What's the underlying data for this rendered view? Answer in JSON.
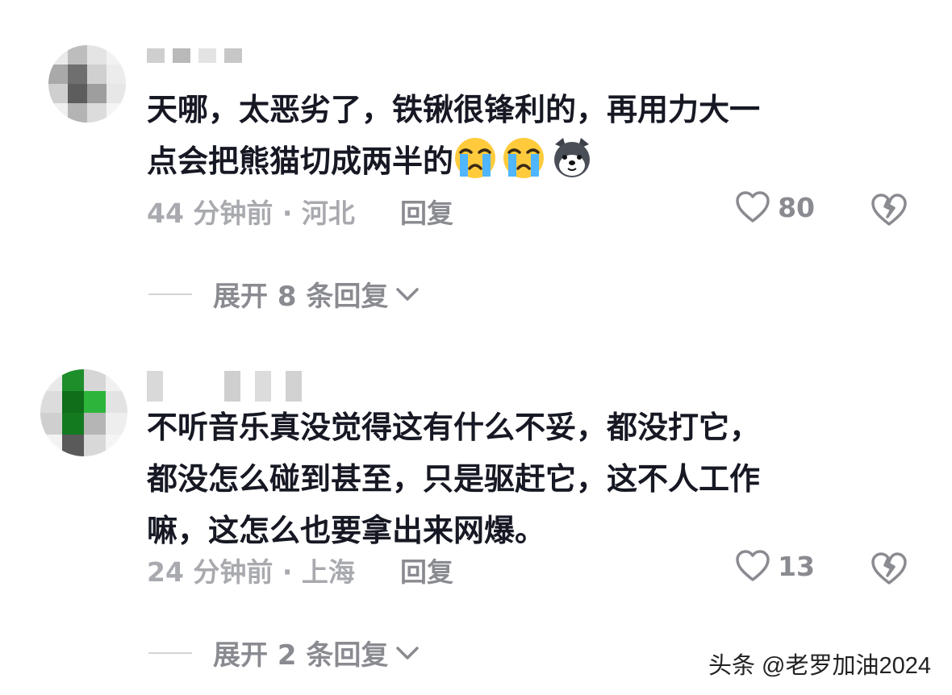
{
  "comments": [
    {
      "text_line1": "天哪，太恶劣了，铁锹很锋利的，再用力大一",
      "text_line2": "点会把熊猫切成两半的",
      "emojis": [
        "crying-emoji",
        "crying-emoji",
        "dog-emoji"
      ],
      "time_location": "44 分钟前 · 河北",
      "reply_label": "回复",
      "like_count": "80",
      "expand_label": "展开 8 条回复"
    },
    {
      "text_line1": "不听音乐真没觉得这有什么不妥，都没打它，",
      "text_line2": "都没怎么碰到甚至，只是驱赶它，这不人工作",
      "text_line3": "嘛，这怎么也要拿出来网爆。",
      "time_location": "24 分钟前 · 上海",
      "reply_label": "回复",
      "like_count": "13",
      "expand_label": "展开 2 条回复"
    }
  ],
  "icons": {
    "like": "heart-outline-icon",
    "dislike": "broken-heart-icon",
    "expand": "chevron-down-icon"
  },
  "colors": {
    "text": "#161823",
    "meta": "#a9aaaf",
    "muted": "#8a8b91"
  },
  "watermark": "头条 @老罗加油2024"
}
